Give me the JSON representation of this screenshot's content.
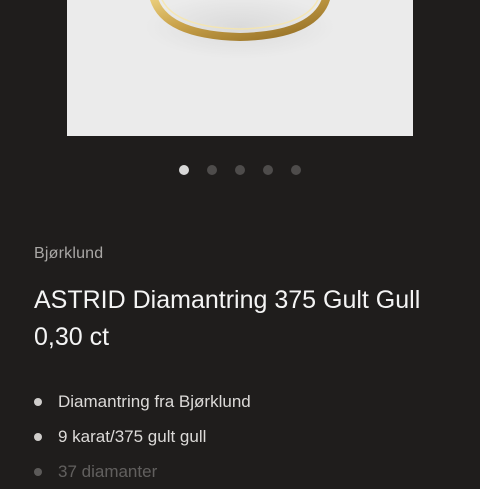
{
  "product": {
    "brand": "Bjørklund",
    "title": "ASTRID Diamantring 375 Gult Gull 0,30 ct",
    "features": [
      "Diamantring fra Bjørklund",
      "9 karat/375 gult gull",
      "37 diamanter"
    ]
  },
  "gallery": {
    "icon": "ring-product-image",
    "dots": 5,
    "active_dot": 1
  },
  "colors": {
    "background": "#1f1d1c",
    "image_background": "#ebebeb",
    "ring_gold": "#c9a24a"
  }
}
